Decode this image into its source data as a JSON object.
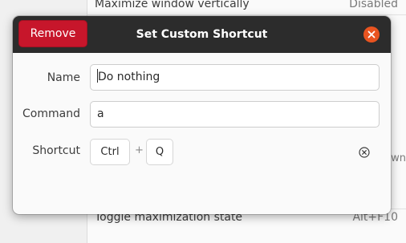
{
  "background": {
    "top_row": {
      "label": "Maximize window vertically",
      "value": "Disabled"
    },
    "bottom_row": {
      "label": "Toggle maximization state",
      "value": "Alt+F10"
    },
    "peek_text": "own"
  },
  "dialog": {
    "title": "Set Custom Shortcut",
    "remove_label": "Remove",
    "close_icon": "close-icon",
    "fields": {
      "name": {
        "label": "Name",
        "value": "Do nothing"
      },
      "command": {
        "label": "Command",
        "value": "a"
      },
      "shortcut": {
        "label": "Shortcut",
        "keys": [
          "Ctrl",
          "Q"
        ],
        "separator": "+"
      }
    }
  },
  "colors": {
    "header": "#2c2c2c",
    "remove_button": "#c7162b",
    "close_button": "#e95420"
  }
}
